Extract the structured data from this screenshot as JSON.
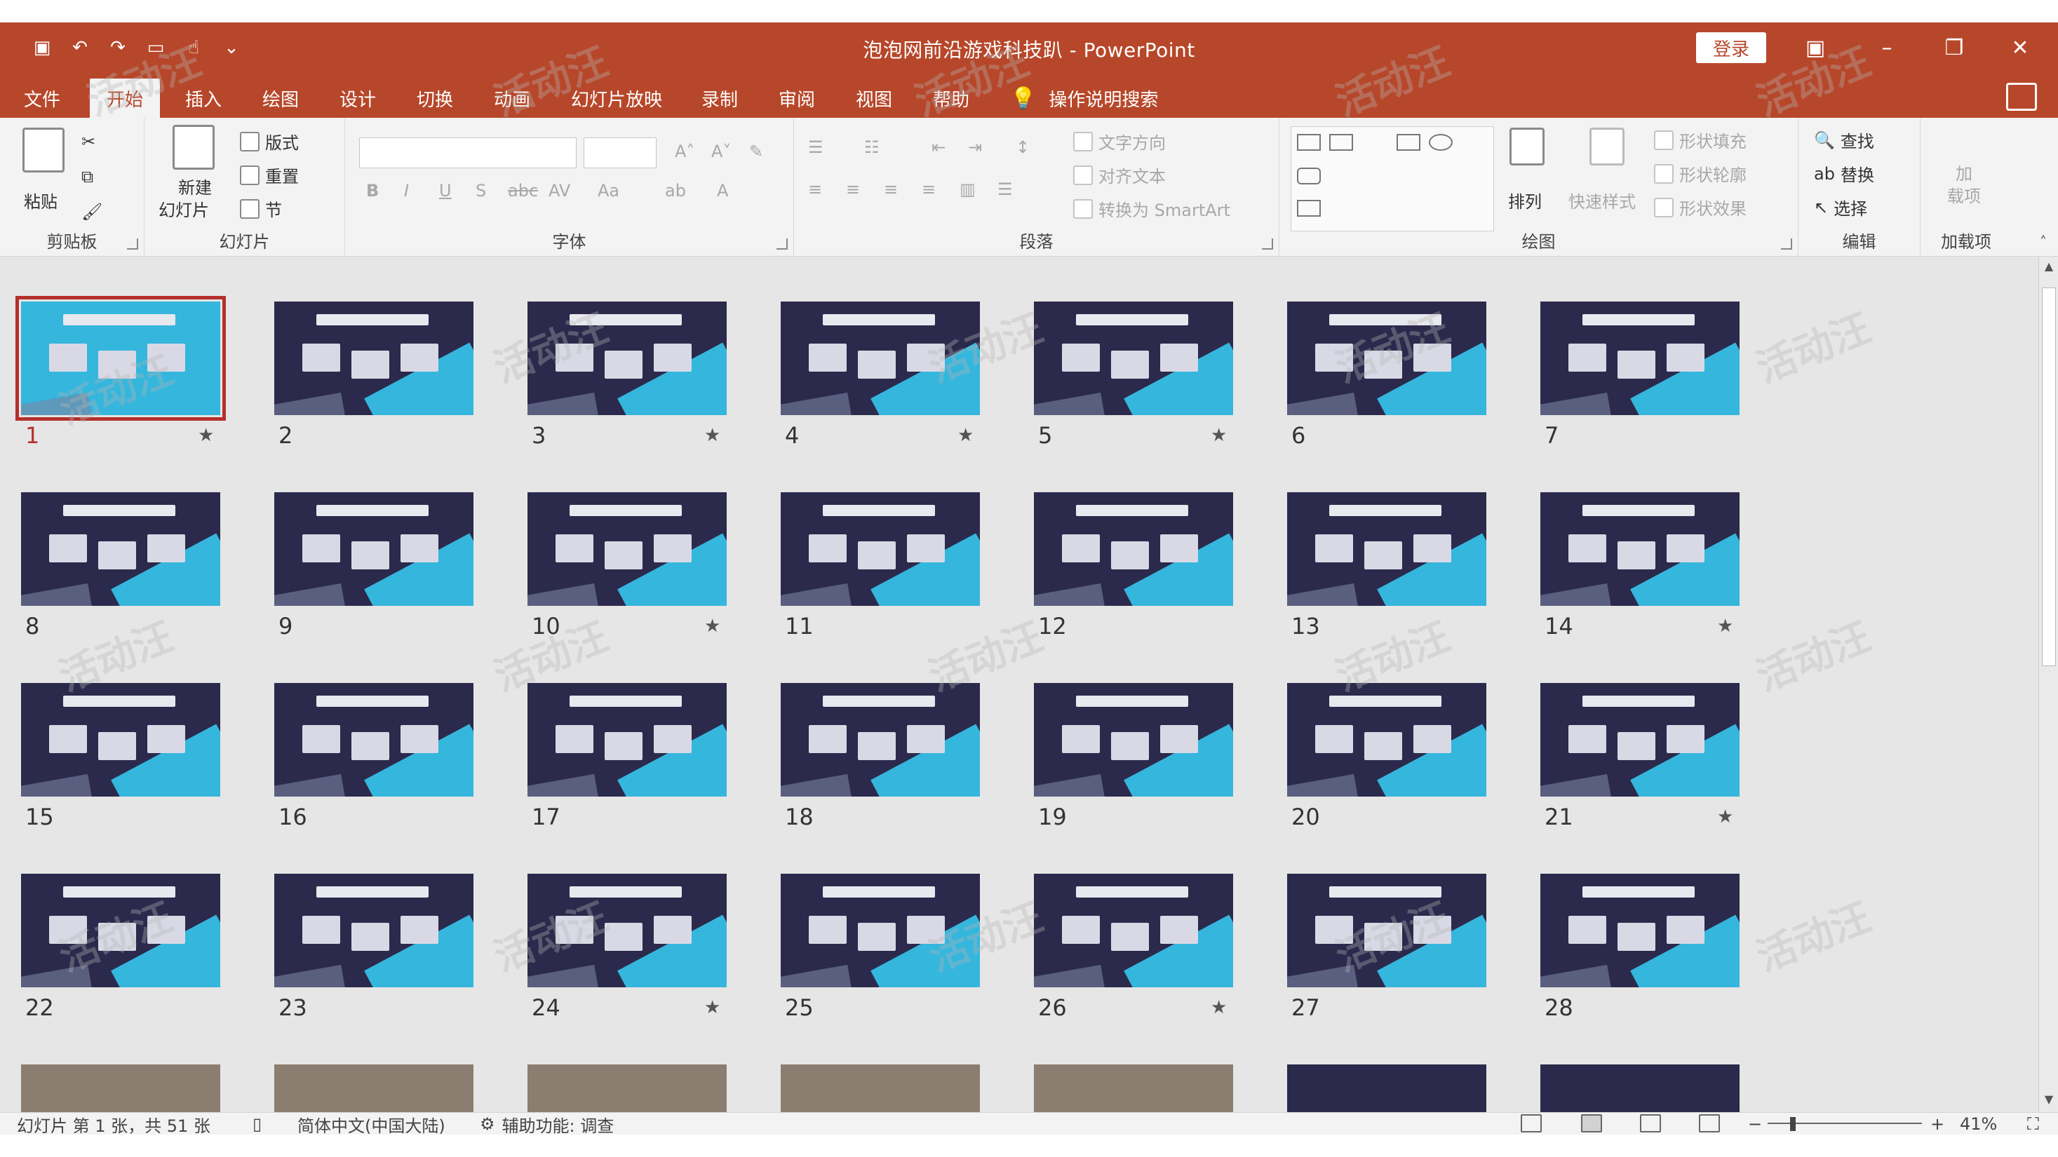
{
  "window": {
    "title": "泡泡网前沿游戏科技趴 - PowerPoint",
    "login": "登录"
  },
  "tabs": [
    "文件",
    "开始",
    "插入",
    "绘图",
    "设计",
    "切换",
    "动画",
    "幻灯片放映",
    "录制",
    "审阅",
    "视图",
    "帮助"
  ],
  "tell_me": "操作说明搜索",
  "ribbon": {
    "clipboard": {
      "label": "剪贴板",
      "paste": "粘贴"
    },
    "slides": {
      "label": "幻灯片",
      "new_slide_1": "新建",
      "new_slide_2": "幻灯片",
      "layout": "版式",
      "reset": "重置",
      "section": "节"
    },
    "font": {
      "label": "字体",
      "bold": "B",
      "italic": "I",
      "underline": "U",
      "shadow": "S",
      "strike": "abc",
      "spacing": "AV",
      "case": "Aa",
      "color": "A"
    },
    "paragraph": {
      "label": "段落",
      "text_direction": "文字方向",
      "align_text": "对齐文本",
      "smartart": "转换为 SmartArt"
    },
    "drawing": {
      "label": "绘图",
      "arrange": "排列",
      "quick_styles": "快速样式",
      "fill": "形状填充",
      "outline": "形状轮廓",
      "effects": "形状效果"
    },
    "editing": {
      "label": "编辑",
      "find": "查找",
      "replace": "替换",
      "select": "选择"
    },
    "addins": {
      "label": "加载项",
      "addin_1": "加",
      "addin_2": "载项"
    }
  },
  "slides": [
    {
      "num": "1",
      "star": true,
      "selected": true
    },
    {
      "num": "2",
      "star": false
    },
    {
      "num": "3",
      "star": true
    },
    {
      "num": "4",
      "star": true
    },
    {
      "num": "5",
      "star": true
    },
    {
      "num": "6",
      "star": false
    },
    {
      "num": "7",
      "star": false
    },
    {
      "num": "8",
      "star": false
    },
    {
      "num": "9",
      "star": false
    },
    {
      "num": "10",
      "star": true
    },
    {
      "num": "11",
      "star": false
    },
    {
      "num": "12",
      "star": false
    },
    {
      "num": "13",
      "star": false
    },
    {
      "num": "14",
      "star": true
    },
    {
      "num": "15",
      "star": false
    },
    {
      "num": "16",
      "star": false
    },
    {
      "num": "17",
      "star": false
    },
    {
      "num": "18",
      "star": false
    },
    {
      "num": "19",
      "star": false
    },
    {
      "num": "20",
      "star": false
    },
    {
      "num": "21",
      "star": true
    },
    {
      "num": "22",
      "star": false
    },
    {
      "num": "23",
      "star": false
    },
    {
      "num": "24",
      "star": true
    },
    {
      "num": "25",
      "star": false
    },
    {
      "num": "26",
      "star": true
    },
    {
      "num": "27",
      "star": false
    },
    {
      "num": "28",
      "star": false
    }
  ],
  "status": {
    "slide_info": "幻灯片 第 1 张，共 51 张",
    "language": "简体中文(中国大陆)",
    "accessibility": "辅助功能: 调查",
    "zoom": "41%"
  },
  "watermark": "活动汪"
}
